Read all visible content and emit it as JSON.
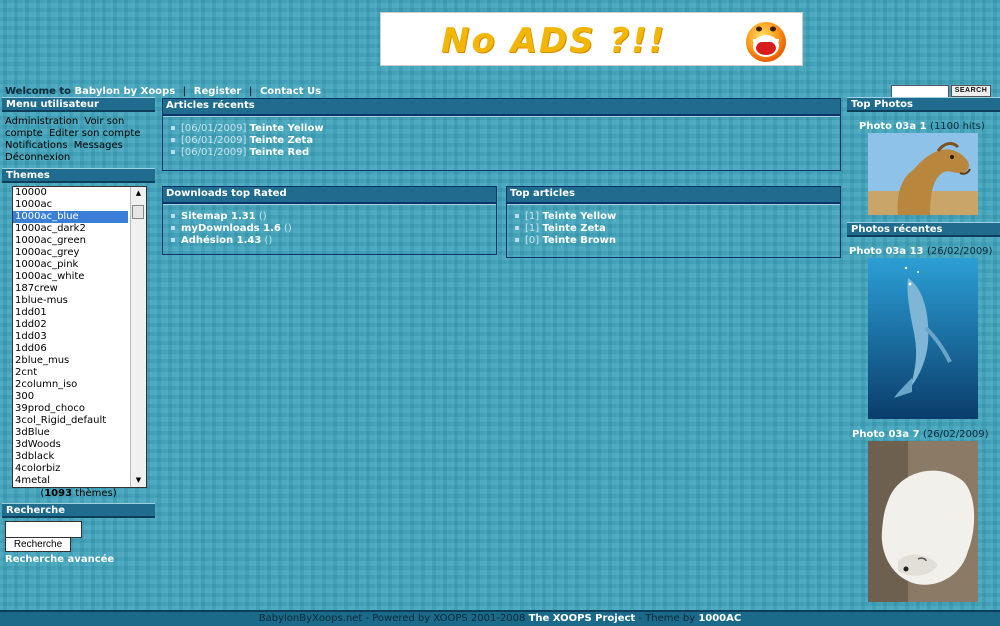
{
  "banner": {
    "text": "No ADS ?!!",
    "icon": "screaming-smiley-icon",
    "text_color": "#f2b705"
  },
  "topbar": {
    "welcome": "Welcome to",
    "site_name": "Babylon by Xoops",
    "links": [
      "Register",
      "Contact Us"
    ],
    "separator": "|",
    "search_button": "SEARCH"
  },
  "menu": {
    "title": "Menu utilisateur",
    "links": [
      "Administration",
      "Voir son compte",
      "Editer son compte",
      "Notifications",
      "Messages",
      "Déconnexion"
    ]
  },
  "themes": {
    "title": "Themes",
    "selected": "1000ac_blue",
    "items": [
      "10000",
      "1000ac",
      "1000ac_blue",
      "1000ac_dark2",
      "1000ac_green",
      "1000ac_grey",
      "1000ac_pink",
      "1000ac_white",
      "187crew",
      "1blue-mus",
      "1dd01",
      "1dd02",
      "1dd03",
      "1dd06",
      "2blue_mus",
      "2cnt",
      "2column_iso",
      "300",
      "39prod_choco",
      "3col_Rigid_default",
      "3dBlue",
      "3dWoods",
      "3dblack",
      "4colorbiz",
      "4metal"
    ],
    "count_open": "(",
    "count": "1093",
    "count_suffix": "thèmes)"
  },
  "search": {
    "title": "Recherche",
    "button": "Recherche",
    "advanced": "Recherche avancée"
  },
  "articles_recents": {
    "title": "Articles récents",
    "items": [
      {
        "date": "[06/01/2009]",
        "name": "Teinte Yellow"
      },
      {
        "date": "[06/01/2009]",
        "name": "Teinte Zeta"
      },
      {
        "date": "[06/01/2009]",
        "name": "Teinte Red"
      }
    ]
  },
  "downloads": {
    "title": "Downloads top Rated",
    "items": [
      {
        "name": "Sitemap 1.31",
        "extra": "()"
      },
      {
        "name": "myDownloads 1.6",
        "extra": "()"
      },
      {
        "name": "Adhésion 1.43",
        "extra": "()"
      }
    ]
  },
  "top_articles": {
    "title": "Top articles",
    "items": [
      {
        "count": "[1]",
        "name": "Teinte Yellow"
      },
      {
        "count": "[1]",
        "name": "Teinte Zeta"
      },
      {
        "count": "[0]",
        "name": "Teinte Brown"
      }
    ]
  },
  "top_photos": {
    "title": "Top Photos",
    "photo_name": "Photo 03a 1",
    "hits": "(1100 hits)",
    "image": "camel-photo"
  },
  "recent_photos": {
    "title": "Photos récentes",
    "items": [
      {
        "name": "Photo 03a 13",
        "date": "(26/02/2009)",
        "image": "dolphin-photo"
      },
      {
        "name": "Photo 03a 7",
        "date": "(26/02/2009)",
        "image": "polar-bear-photo"
      }
    ]
  },
  "footer": {
    "prefix": "BabylonByXoops.net - Powered by XOOPS 2001-2008",
    "project": "The XOOPS Project",
    "mid": "- Theme by",
    "author": "1000AC"
  },
  "colors": {
    "background": "#3fa3bb",
    "header": "#1f6c8f",
    "border": "#0d3568"
  }
}
